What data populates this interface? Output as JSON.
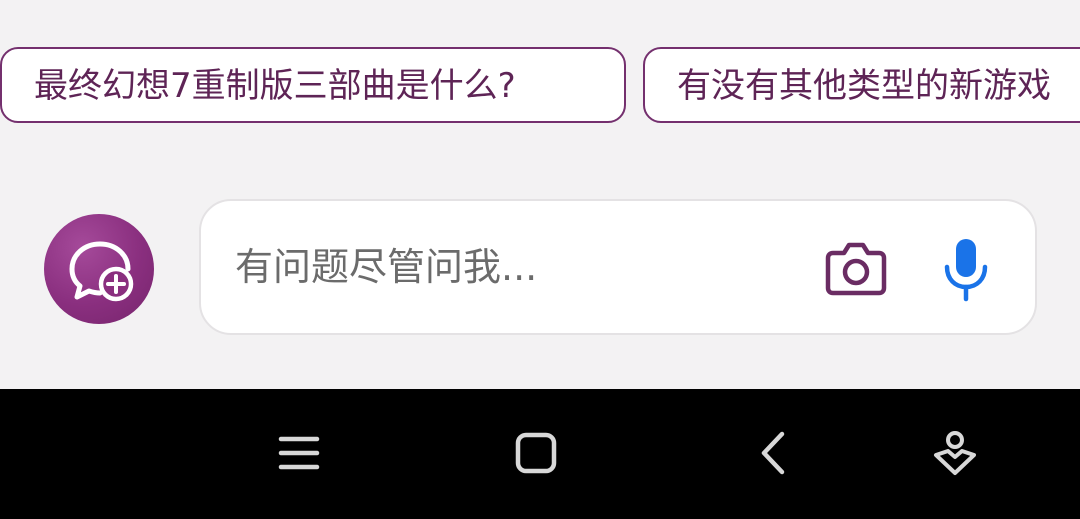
{
  "suggestions": [
    {
      "label": "最终幻想7重制版三部曲是什么?"
    },
    {
      "label": "有没有其他类型的新游戏"
    }
  ],
  "new_chat": {
    "icon": "chat-bubble-plus-icon"
  },
  "input": {
    "placeholder": "有问题尽管问我..."
  },
  "input_actions": {
    "camera_icon": "camera-icon",
    "mic_icon": "microphone-icon"
  },
  "nav": {
    "recent_icon": "recent-apps-icon",
    "home_icon": "home-icon",
    "back_icon": "back-icon",
    "assist_icon": "assistant-icon"
  },
  "colors": {
    "accent": "#7a2a72",
    "mic_blue": "#1a73e8",
    "background": "#f3f2f3",
    "navbar": "#000000"
  }
}
